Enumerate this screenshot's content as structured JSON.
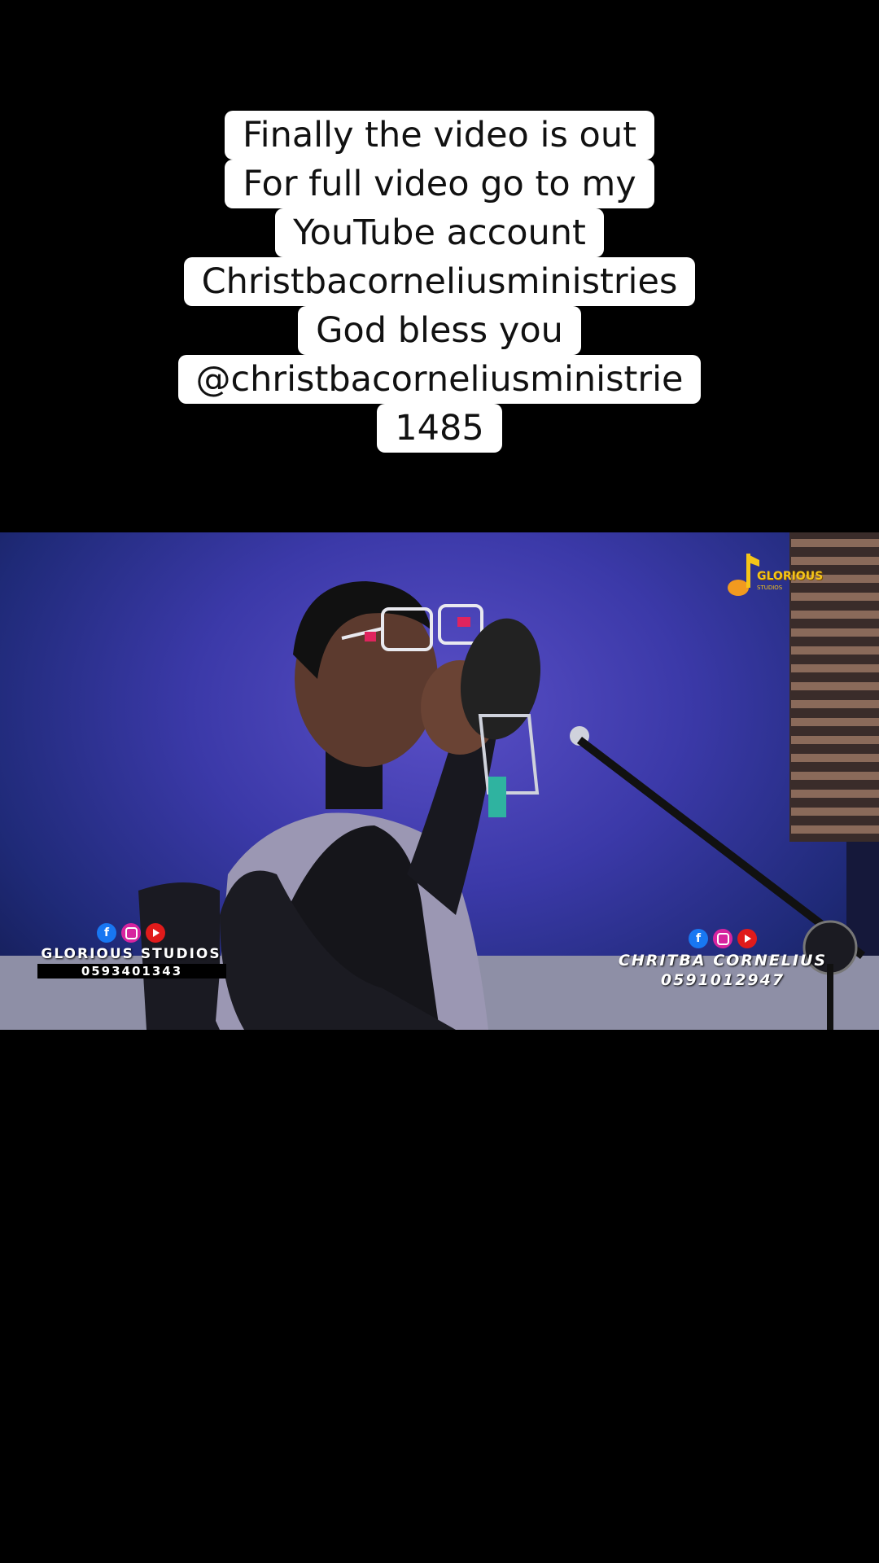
{
  "caption": {
    "lines": [
      "Finally the video is out",
      "For full video go to my",
      "YouTube account",
      "Christbacorneliusministries",
      "God bless you",
      "@christbacorneliusministrie",
      "1485"
    ]
  },
  "video": {
    "studio_logo": {
      "text": "GLORIOUS",
      "sub": "STUDIOS"
    },
    "lower_third_left": {
      "social_icons": [
        "facebook-icon",
        "instagram-icon",
        "youtube-icon"
      ],
      "name": "GLORIOUS STUDIOS",
      "phone": "0593401343"
    },
    "lower_third_right": {
      "social_icons": [
        "facebook-icon",
        "instagram-icon",
        "youtube-icon"
      ],
      "name": "CHRITBA CORNELIUS",
      "phone": "0591012947"
    }
  },
  "colors": {
    "background": "#000000",
    "caption_bg": "#ffffff",
    "caption_text": "#111111",
    "studio_wall": "#3b39a8",
    "logo_gold": "#f5c518"
  }
}
